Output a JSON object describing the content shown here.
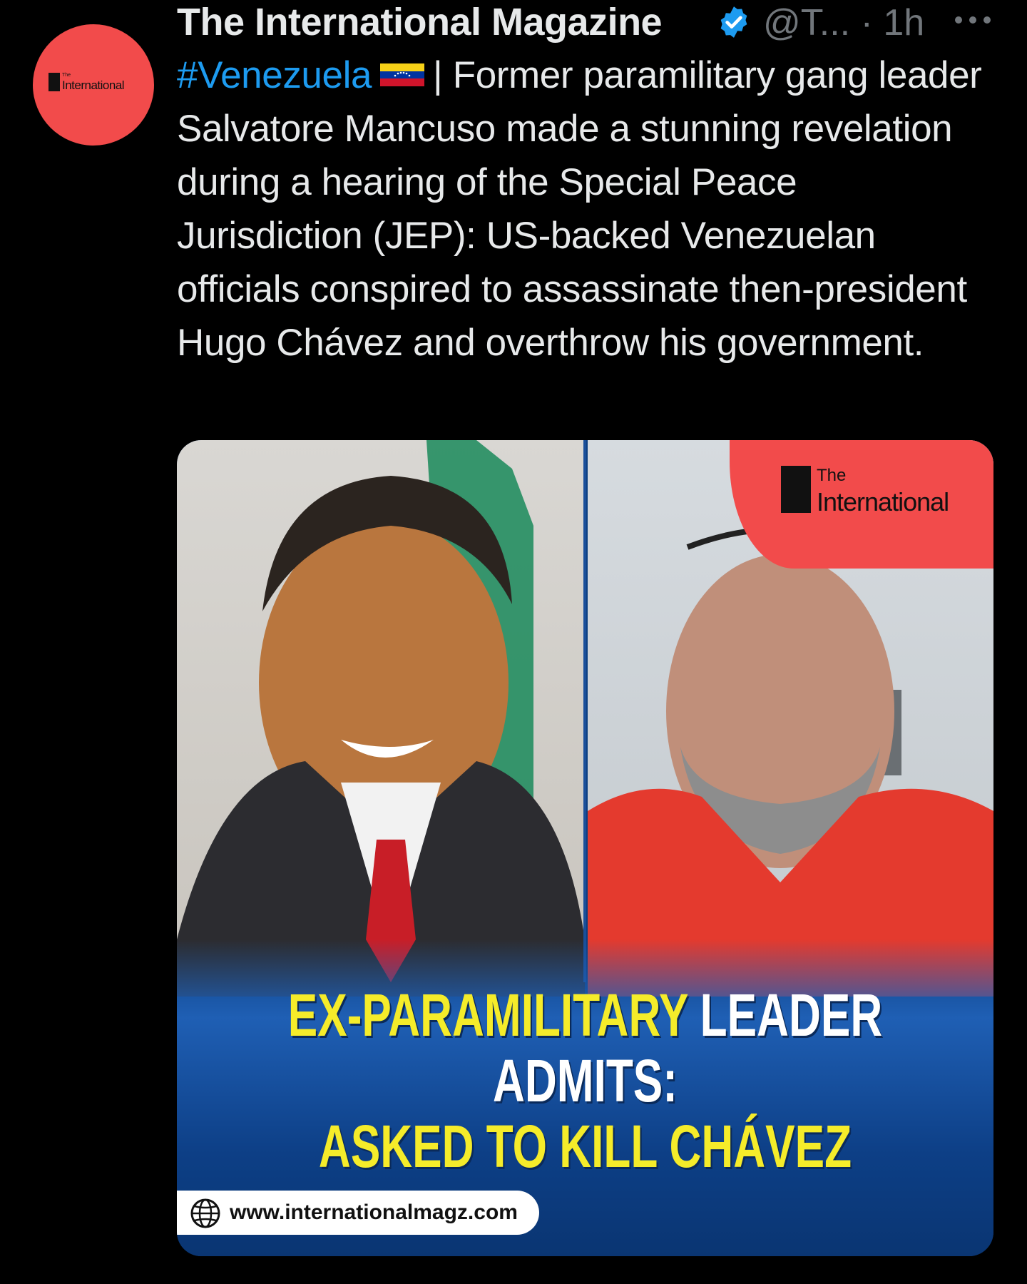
{
  "author": {
    "name": "The International Magazine",
    "handle": "@T...",
    "separator": "·",
    "time": "1h",
    "avatar_label_small": "The",
    "avatar_label_big": "International"
  },
  "tweet": {
    "hashtag": "#Venezuela",
    "flag": "venezuela-flag",
    "text": "| Former paramilitary gang leader Salvatore Mancuso made a stunning revelation during a hearing of the Special Peace Jurisdiction (JEP): US-backed Venezuelan officials conspired to assassinate then-president Hugo Chávez and overthrow his government."
  },
  "media": {
    "brand_small": "The",
    "brand_big": "International",
    "headline_part1": "EX-PARAMILITARY",
    "headline_part2": "LEADER ADMITS:",
    "headline_line2": "ASKED TO KILL CHÁVEZ",
    "url": "www.internationalmagz.com"
  },
  "colors": {
    "accent_blue": "#1d9bf0",
    "brand_red": "#f24b4b",
    "headline_yellow": "#f5ec2a",
    "muted": "#71767b"
  },
  "icons": [
    "verified-icon",
    "more-icon",
    "globe-icon"
  ]
}
